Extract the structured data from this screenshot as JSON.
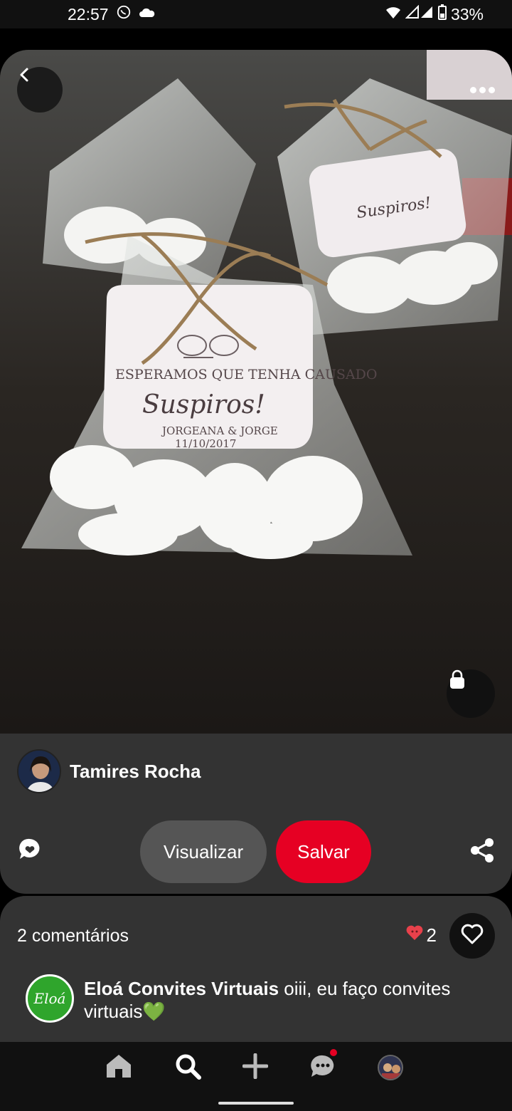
{
  "status_bar": {
    "time": "22:57",
    "battery": "33%",
    "icons": [
      "whatsapp-icon",
      "cloud-icon",
      "wifi-icon",
      "signal-icon",
      "battery-icon"
    ]
  },
  "pin": {
    "tag_text": {
      "line1": "ESPERAMOS QUE TENHA CAUSADO",
      "line2": "Suspiros!",
      "line3": "JORGEANA & JORGE",
      "line4": "11/10/2017"
    }
  },
  "creator": {
    "name": "Tamires Rocha"
  },
  "actions": {
    "visualizar_label": "Visualizar",
    "salvar_label": "Salvar",
    "salvar_color": "#e60023"
  },
  "comments": {
    "count_label": "2 comentários",
    "reaction_count": "2",
    "items": [
      {
        "avatar_text": "Eloá",
        "author": "Eloá Convites Virtuais",
        "text": " oiii, eu faço convites virtuais💚"
      }
    ]
  },
  "bottom_nav": {
    "items": [
      "home-icon",
      "search-icon",
      "add-icon",
      "messages-icon",
      "profile-avatar"
    ]
  }
}
